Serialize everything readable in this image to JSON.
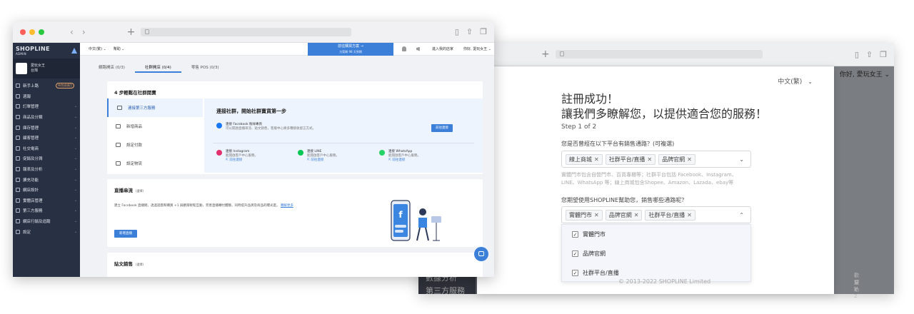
{
  "back_window": {
    "lang": "中文(繁)",
    "greeting": "你好, 愛玩女王",
    "title_line1": "註冊成功！",
    "title_line2": "讓我們多瞭解您，以提供適合您的服務！",
    "step": "Step 1 of 2",
    "q1": "您是否曾經在以下平台有銷售通路？(可複選)",
    "q1_tags": [
      "線上商城",
      "社群平台/直播",
      "品牌官網"
    ],
    "hint1": "實體門市包含自營門市、百貨專櫃等；社群平台包括 Facebook、Instagram、",
    "hint2": "LINE、WhatsApp 等；線上商城包含Shopee、Amazon、Lazada、ebay等",
    "q2": "您期望使用SHOPLINE幫助您，銷售哪些通路呢？",
    "q2_tags": [
      "實體門市",
      "品牌官網",
      "社群平台/直播"
    ],
    "options": [
      "實體門市",
      "品牌官網",
      "社群平台/直播"
    ],
    "copyright": "© 2013-2022 SHOPLINE Limited",
    "side_item_1": "數據分析",
    "side_item_2": "第三方服務",
    "faded_1": "歡迎 V",
    "faded_2": "幫助 2"
  },
  "front_window": {
    "logo": "SHOPLINE",
    "logo_sub": "ADMIN",
    "store_name": "愛玩女王",
    "store_region": "台灣",
    "menu": [
      {
        "label": "新手上路",
        "badge": "待完成項目"
      },
      {
        "label": "週報"
      },
      {
        "label": "訂單管理"
      },
      {
        "label": "商品及分類"
      },
      {
        "label": "庫存管理"
      },
      {
        "label": "顧客管理"
      },
      {
        "label": "社交電商"
      },
      {
        "label": "促銷及分潤"
      },
      {
        "label": "報表及分析"
      },
      {
        "label": "擴充功能"
      },
      {
        "label": "網店設計"
      },
      {
        "label": "實體店管理"
      },
      {
        "label": "第三方服務"
      },
      {
        "label": "網店行銷及追蹤"
      },
      {
        "label": "設定"
      }
    ],
    "topbar": {
      "lang": "中文(繁)",
      "help": "幫助",
      "upgrade": "前往購買方案 →",
      "upgrade_sub": "方案剩 98 天到期",
      "manage": "進入我的店家",
      "greeting": "你好, 愛玩女王"
    },
    "tabs": [
      "網路開店 (0/3)",
      "社群開店 (0/4)",
      "零售 POS (0/3)"
    ],
    "card1_title": "4 步輕鬆在社群開賣",
    "steps": [
      "連接第三方服務",
      "新增商品",
      "設定付款",
      "設定物流"
    ],
    "panel_title": "連接社群，開始社群賣貨第一步",
    "fb_title": "連接 Facebook 粉絲專頁",
    "fb_sub": "可以開啟直播串流、貼文銷售，客服中心將多種接收留言方式。",
    "connect_button": "前往連接",
    "channels": [
      {
        "name": "連接 Instagram",
        "sub1": "能開啟客戶中心服務。",
        "link": "前往連接"
      },
      {
        "name": "連接 LINE",
        "sub1": "能開啟客戶中心服務。",
        "link": "前往連接"
      },
      {
        "name": "連接 WhatsApp",
        "sub1": "能開啟客戶中心服務。",
        "link": "前往連接"
      }
    ],
    "card2_title": "直播串流",
    "card2_tag": "(選擇)",
    "card2_desc": "建立 Facebook 直播間，透過遊戲和購買 +1 與觀眾輕鬆互動，完善直播轉付體驗，同時提升品牌及商品的曝光度。",
    "card2_link": "瞭解更多",
    "card2_button": "新增直播",
    "card3_title": "貼文銷售",
    "card3_tag": "(選擇)"
  },
  "colors": {
    "accent": "#3b7fd9",
    "sidebar": "#283044",
    "content_bg": "#f1f2f5",
    "dot_red": "#fe5f57",
    "dot_yellow": "#febc2e",
    "dot_green": "#28c840"
  }
}
